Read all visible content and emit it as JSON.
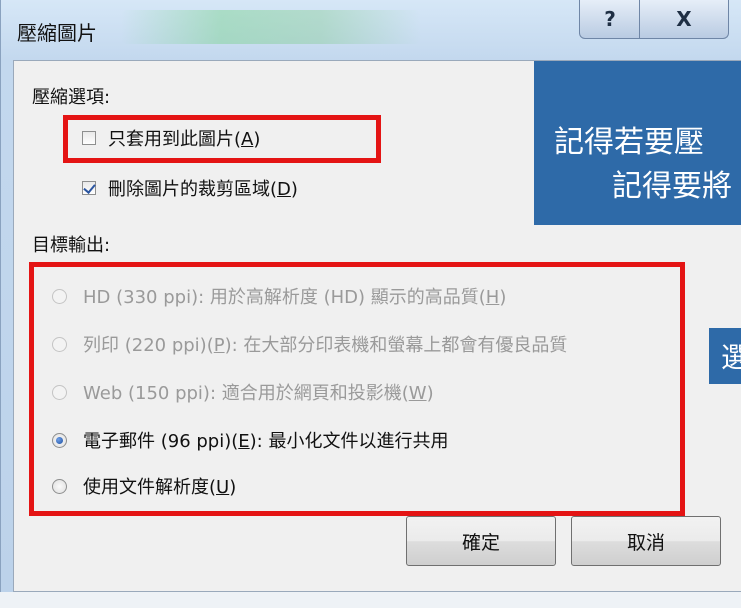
{
  "dialog": {
    "title": "壓縮圖片",
    "help_button": "?",
    "close_button": "X"
  },
  "compression_options": {
    "label": "壓縮選項:",
    "apply_only_this": {
      "label": "只套用到此圖片(",
      "key": "A",
      "suffix": ")",
      "checked": false
    },
    "delete_cropped": {
      "label": "刪除圖片的裁剪區域(",
      "key": "D",
      "suffix": ")",
      "checked": true
    }
  },
  "target_output": {
    "label": "目標輸出:",
    "options": [
      {
        "text": "HD (330 ppi): 用於高解析度 (HD) 顯示的高品質(",
        "key": "H",
        "suffix": ")",
        "enabled": false,
        "selected": false
      },
      {
        "text": "列印 (220 ppi)(",
        "key": "P",
        "text2": "): 在大部分印表機和螢幕上都會有優良品質",
        "enabled": false,
        "selected": false
      },
      {
        "text": "Web (150 ppi): 適合用於網頁和投影機(",
        "key": "W",
        "suffix": ")",
        "enabled": false,
        "selected": false
      },
      {
        "text": "電子郵件 (96 ppi)(",
        "key": "E",
        "text2": "): 最小化文件以進行共用",
        "enabled": true,
        "selected": true
      },
      {
        "text": "使用文件解析度(",
        "key": "U",
        "suffix": ")",
        "enabled": true,
        "selected": false
      }
    ]
  },
  "buttons": {
    "ok": "確定",
    "cancel": "取消"
  },
  "overlay": {
    "line1": "記得若要壓",
    "line2": "記得要將",
    "small": "選"
  },
  "colors": {
    "highlight_red": "#e41414",
    "overlay_blue": "#2e6aa8"
  }
}
